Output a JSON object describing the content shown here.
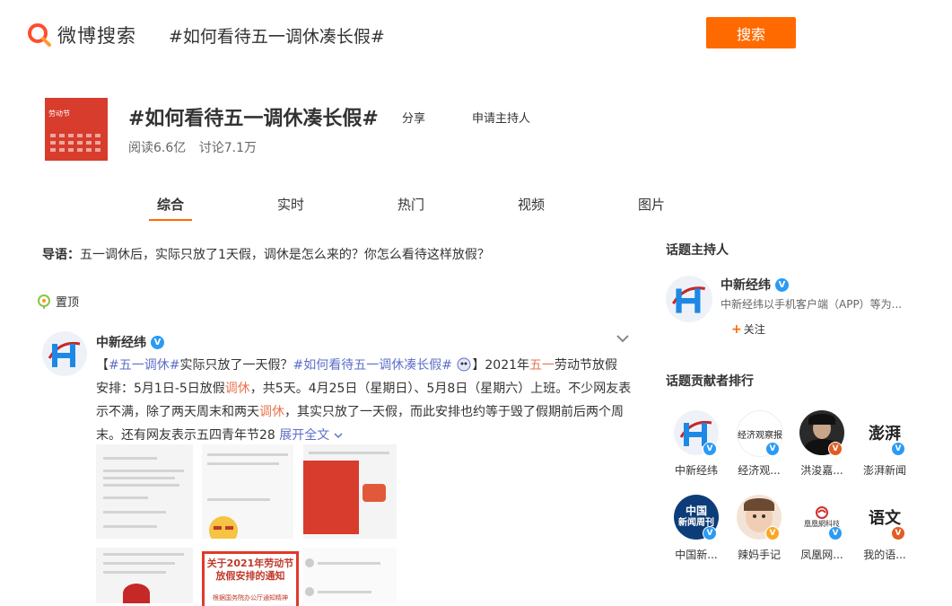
{
  "header": {
    "logo_text": "微博搜索",
    "query": "#如何看待五一调休凑长假#",
    "search_label": "搜索"
  },
  "topic": {
    "cover_caption": "劳动节",
    "title": "#如何看待五一调休凑长假#",
    "share_label": "分享",
    "apply_host_label": "申请主持人",
    "reads": "阅读6.6亿",
    "discussions": "讨论7.1万"
  },
  "tabs": [
    {
      "label": "综合",
      "active": true
    },
    {
      "label": "实时"
    },
    {
      "label": "热门"
    },
    {
      "label": "视频"
    },
    {
      "label": "图片"
    }
  ],
  "lead": {
    "label": "导语：",
    "text": "五一调休后，实际只放了1天假，调休是怎么来的？你怎么看待这样放假？"
  },
  "pinned_label": "置顶",
  "post": {
    "author": "中新经纬",
    "line1_a": "【",
    "line1_tag1": "#五一调休#",
    "line1_b": "实际只放了一天假？",
    "line1_tag2": "#如何看待五一调休凑长假#",
    "line1_c": "】2021年",
    "line1_hl": "五一",
    "line1_d": "劳动节放假",
    "line2_a": "安排：5月1日-5日放假",
    "line2_hl": "调休",
    "line2_b": "，共5天。4月25日（星期日）、5月8日（星期六）上班。不少网友表",
    "line3_a": "示不满，除了两天周末和两天",
    "line3_hl": "调休",
    "line3_b": "，其实只放了一天假，而此安排也约等于毁了假期前后两个周",
    "line4_a": "末。还有网友表示五四青年节28",
    "expand_label": "展开全文",
    "images": {
      "doc_title": "关于2021年劳动节放假安排的通知",
      "doc_sub": "根据国务院办公厅通知精神"
    }
  },
  "sidebar": {
    "host_title": "话题主持人",
    "host": {
      "name": "中新经纬",
      "desc": "中新经纬以手机客户端（APP）等为...",
      "follow_label": "关注"
    },
    "contrib_title": "话题贡献者排行",
    "contributors": [
      {
        "name": "中新经纬",
        "badge": "blue"
      },
      {
        "name": "经济观...",
        "badge": "blue",
        "logo": "经济观察报"
      },
      {
        "name": "洪浚嘉...",
        "badge": "red"
      },
      {
        "name": "澎湃新闻",
        "badge": "blue",
        "logo": "澎湃"
      },
      {
        "name": "中国新...",
        "badge": "blue",
        "logo_top": "中国",
        "logo_bottom": "新闻周刊"
      },
      {
        "name": "辣妈手记",
        "badge": "gold"
      },
      {
        "name": "凤凰网...",
        "badge": "blue",
        "logo": "凰凰網科技"
      },
      {
        "name": "我的语...",
        "badge": "red",
        "logo": "语文"
      }
    ]
  },
  "colors": {
    "accent": "#ff6a00",
    "highlight": "#eb7350",
    "link": "#5d6fc8",
    "verified": "#2b9bf4"
  }
}
